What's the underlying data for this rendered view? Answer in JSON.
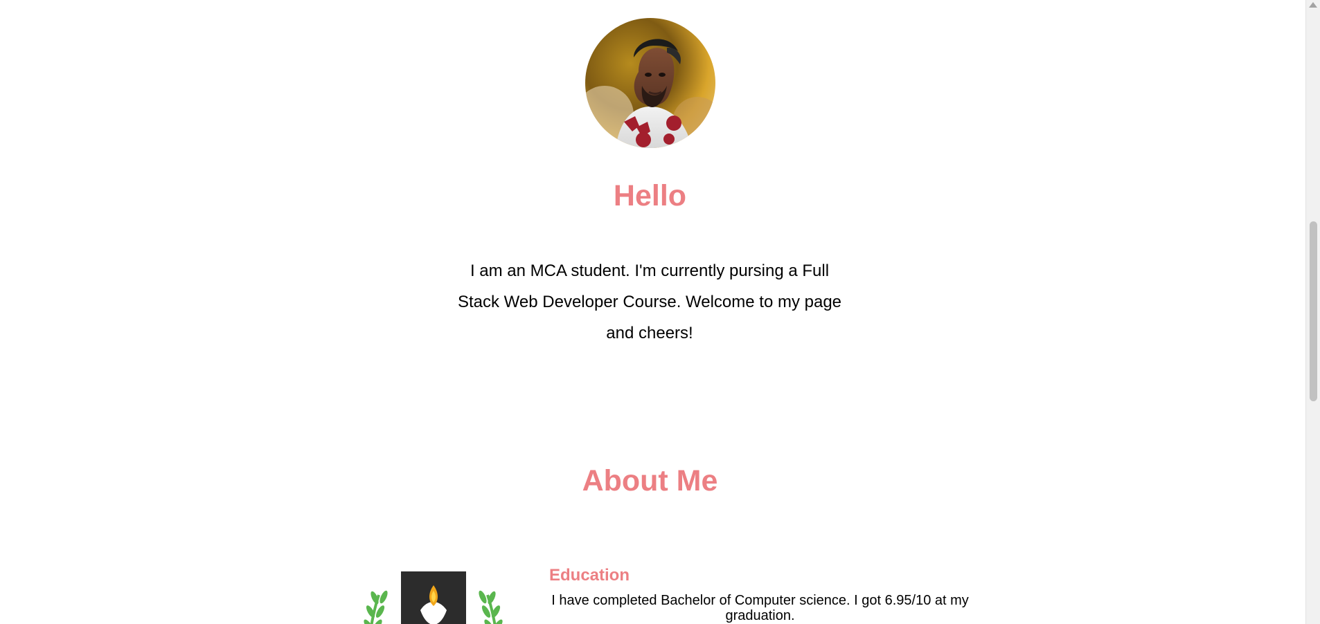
{
  "hero": {
    "title": "Hello",
    "intro": "I am an MCA student. I'm currently pursing a Full Stack Web Developer Course. Welcome to my page and cheers!"
  },
  "about": {
    "title": "About Me",
    "education": {
      "title": "Education",
      "text": "I have completed Bachelor of Computer science. I got 6.95/10 at my graduation."
    }
  },
  "colors": {
    "accent": "#ec7f83",
    "text": "#000000",
    "background": "#ffffff"
  },
  "icons": {
    "avatar": "profile-photo-avatar",
    "education_logo": "laurel-shield-logo",
    "scroll_up": "chevron-up-icon"
  }
}
